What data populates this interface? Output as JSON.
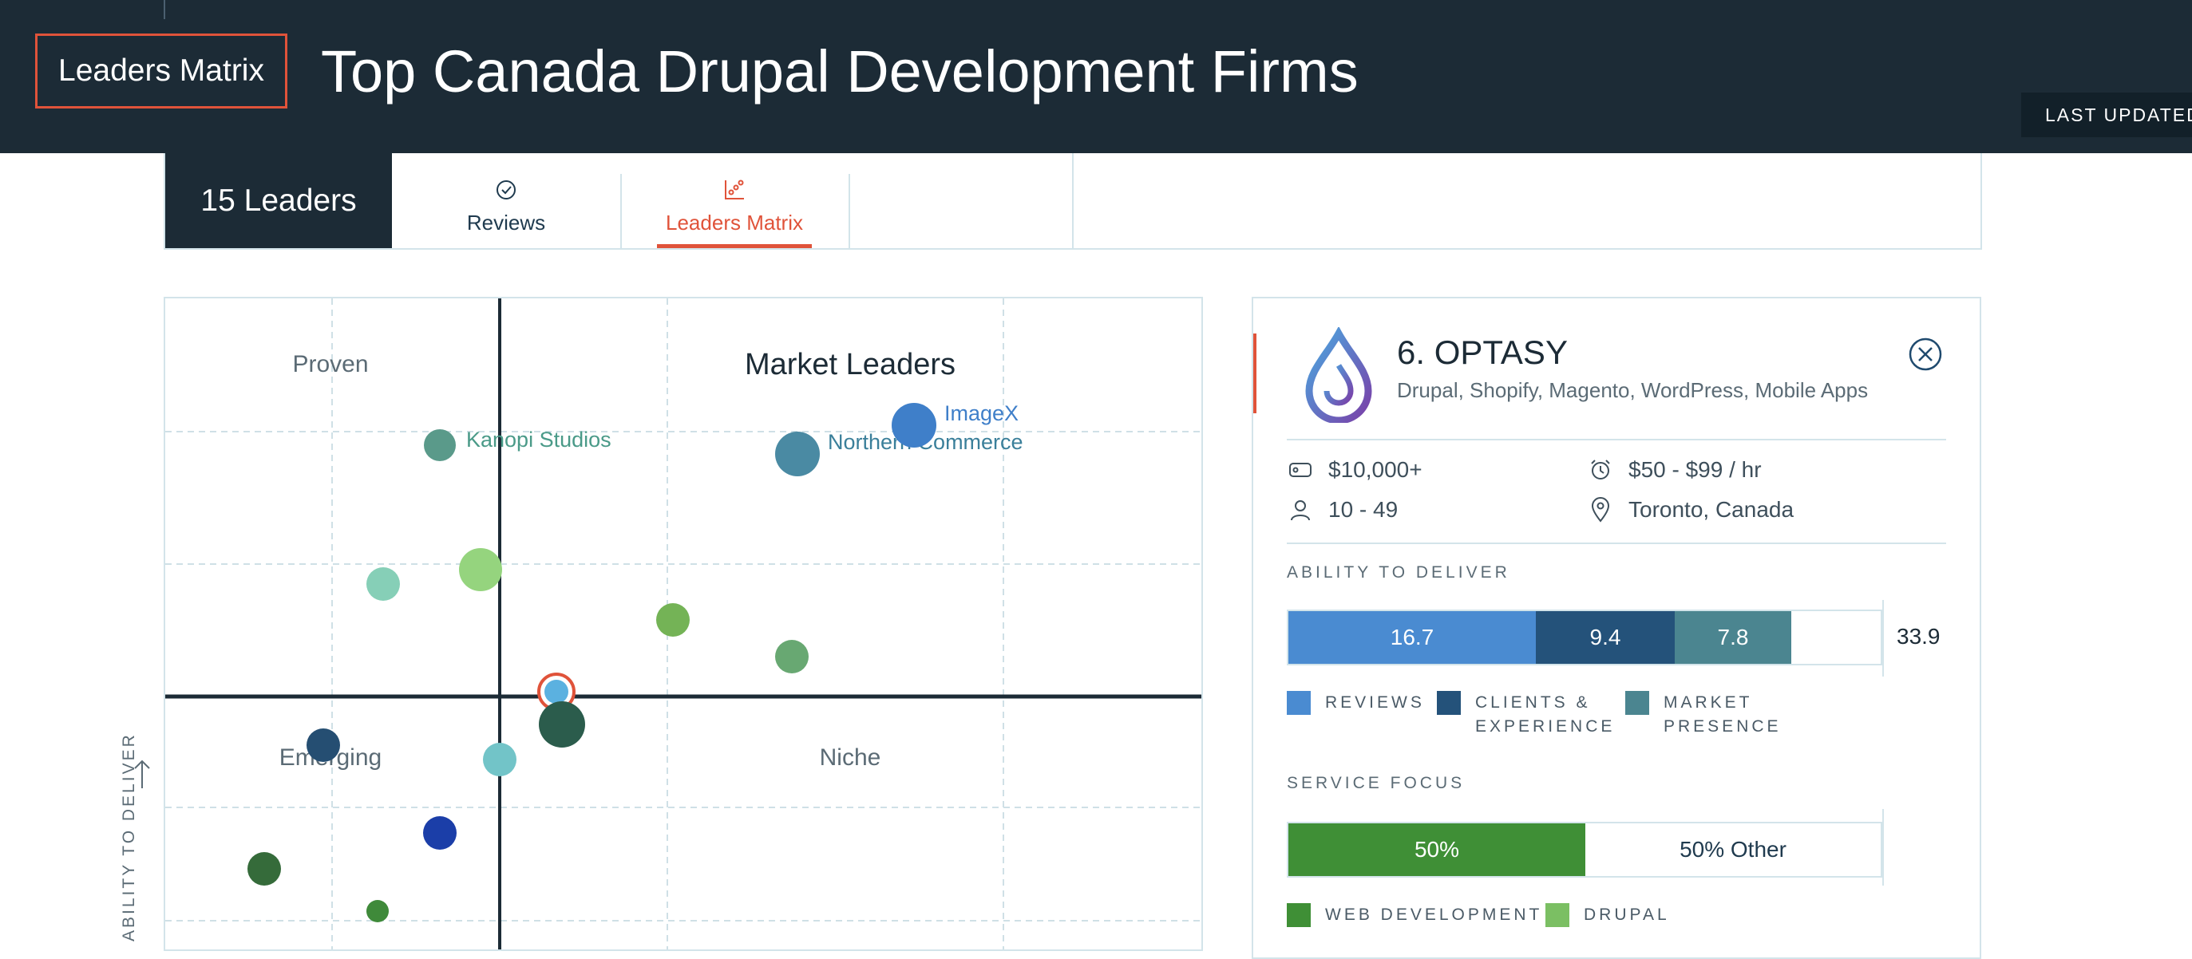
{
  "header": {
    "badge": "Leaders Matrix",
    "title": "Top Canada Drupal Development Firms",
    "last_updated": "LAST UPDATED"
  },
  "tabs": {
    "leaders_count": "15 Leaders",
    "reviews": "Reviews",
    "matrix": "Leaders Matrix"
  },
  "matrix": {
    "quadrants": {
      "proven": "Proven",
      "market_leaders": "Market Leaders",
      "emerging": "Emerging",
      "niche": "Niche"
    },
    "axis_label": "ABILITY TO DELIVER",
    "points": [
      {
        "label": "Kanopi Studios",
        "fill": "#5a9a8a"
      },
      {
        "label": "Northern Commerce",
        "fill": "#4a8aa3"
      },
      {
        "label": "ImageX",
        "fill": "#3f7fc9"
      },
      {
        "label": "",
        "fill": "#86cfb7"
      },
      {
        "label": "",
        "fill": "#95d47e"
      },
      {
        "label": "",
        "fill": "#74b356"
      },
      {
        "label": "",
        "fill": "#68a872"
      },
      {
        "label": "",
        "fill": "#5bb1e0",
        "selected": true
      },
      {
        "label": "",
        "fill": "#2b5c4c"
      },
      {
        "label": "",
        "fill": "#254e72"
      },
      {
        "label": "",
        "fill": "#72c4c8"
      },
      {
        "label": "",
        "fill": "#1b3ea8"
      },
      {
        "label": "",
        "fill": "#356b3a"
      },
      {
        "label": "",
        "fill": "#3f8a3a"
      }
    ]
  },
  "detail": {
    "name": "6. OPTASY",
    "services": "Drupal, Shopify, Magento, WordPress, Mobile Apps",
    "min_project": "$10,000+",
    "hourly_rate": "$50 - $99 / hr",
    "employees": "10 - 49",
    "location": "Toronto, Canada",
    "ability_title": "ABILITY TO DELIVER",
    "ability": {
      "reviews": "16.7",
      "clients": "9.4",
      "market": "7.8",
      "total": "33.9"
    },
    "ability_legend": {
      "reviews": "REVIEWS",
      "clients_line1": "CLIENTS &",
      "clients_line2": "EXPERIENCE",
      "market_line1": "MARKET",
      "market_line2": "PRESENCE"
    },
    "focus_title": "SERVICE FOCUS",
    "focus": {
      "web_dev_pct": "50%",
      "other": "50% Other"
    },
    "focus_legend": {
      "web_dev": "WEB DEVELOPMENT",
      "drupal": "DRUPAL"
    },
    "colors": {
      "reviews": "#4a8bd1",
      "clients": "#24527a",
      "market": "#4b8590",
      "web_dev": "#3f8f36",
      "drupal": "#7bbf63",
      "accent": "#e0533a"
    }
  }
}
